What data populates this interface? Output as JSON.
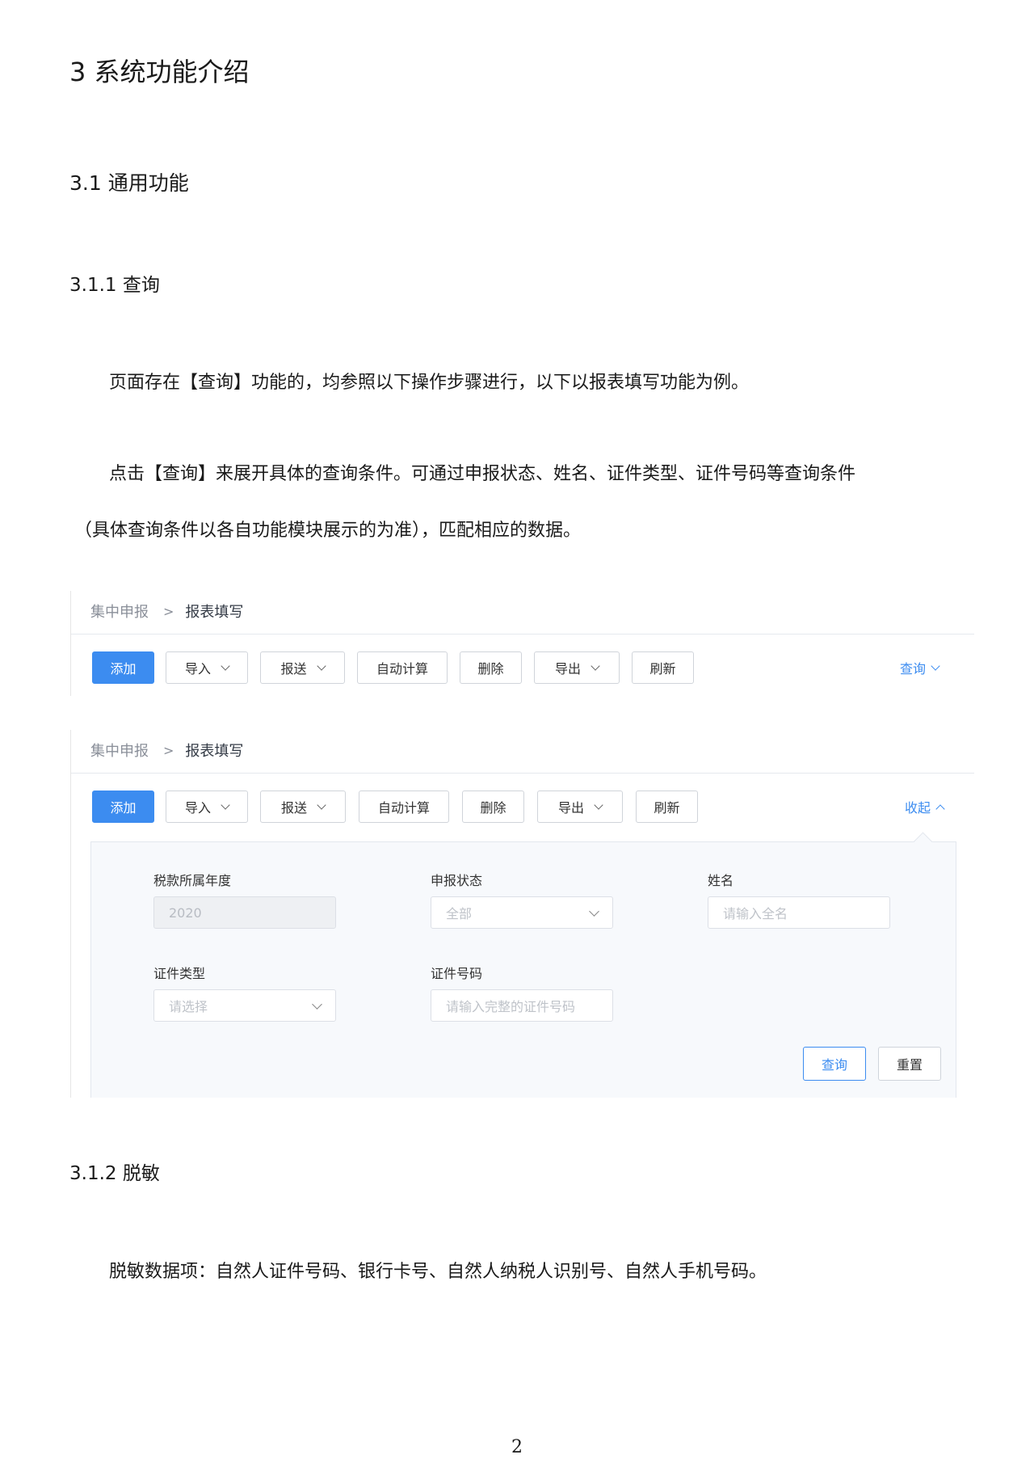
{
  "doc": {
    "h1": "3 系统功能介绍",
    "h2": "3.1 通用功能",
    "h3_query": "3.1.1 查询",
    "p1": "页面存在【查询】功能的，均参照以下操作步骤进行，以下以报表填写功能为例。",
    "p2": "点击【查询】来展开具体的查询条件。可通过申报状态、姓名、证件类型、证件号码等查询条件",
    "p3": "（具体查询条件以各自功能模块展示的为准），匹配相应的数据。",
    "h3_mask": "3.1.2 脱敏",
    "p4": "脱敏数据项：自然人证件号码、银行卡号、自然人纳税人识别号、自然人手机号码。",
    "page_number": "2"
  },
  "breadcrumb": {
    "parent": "集中申报",
    "separator": ">",
    "current": "报表填写"
  },
  "toolbar": {
    "add": "添加",
    "import": "导入",
    "submit": "报送",
    "auto_calc": "自动计算",
    "delete": "删除",
    "export": "导出",
    "refresh": "刷新",
    "query_toggle": "查询",
    "collapse_toggle": "收起"
  },
  "form": {
    "tax_year_label": "税款所属年度",
    "tax_year_value": "2020",
    "status_label": "申报状态",
    "status_value": "全部",
    "name_label": "姓名",
    "name_placeholder": "请输入全名",
    "id_type_label": "证件类型",
    "id_type_placeholder": "请选择",
    "id_number_label": "证件号码",
    "id_number_placeholder": "请输入完整的证件号码",
    "query_button": "查询",
    "reset_button": "重置"
  },
  "colors": {
    "primary": "#3c8cf0",
    "panel_bg": "#f7f9fc"
  }
}
